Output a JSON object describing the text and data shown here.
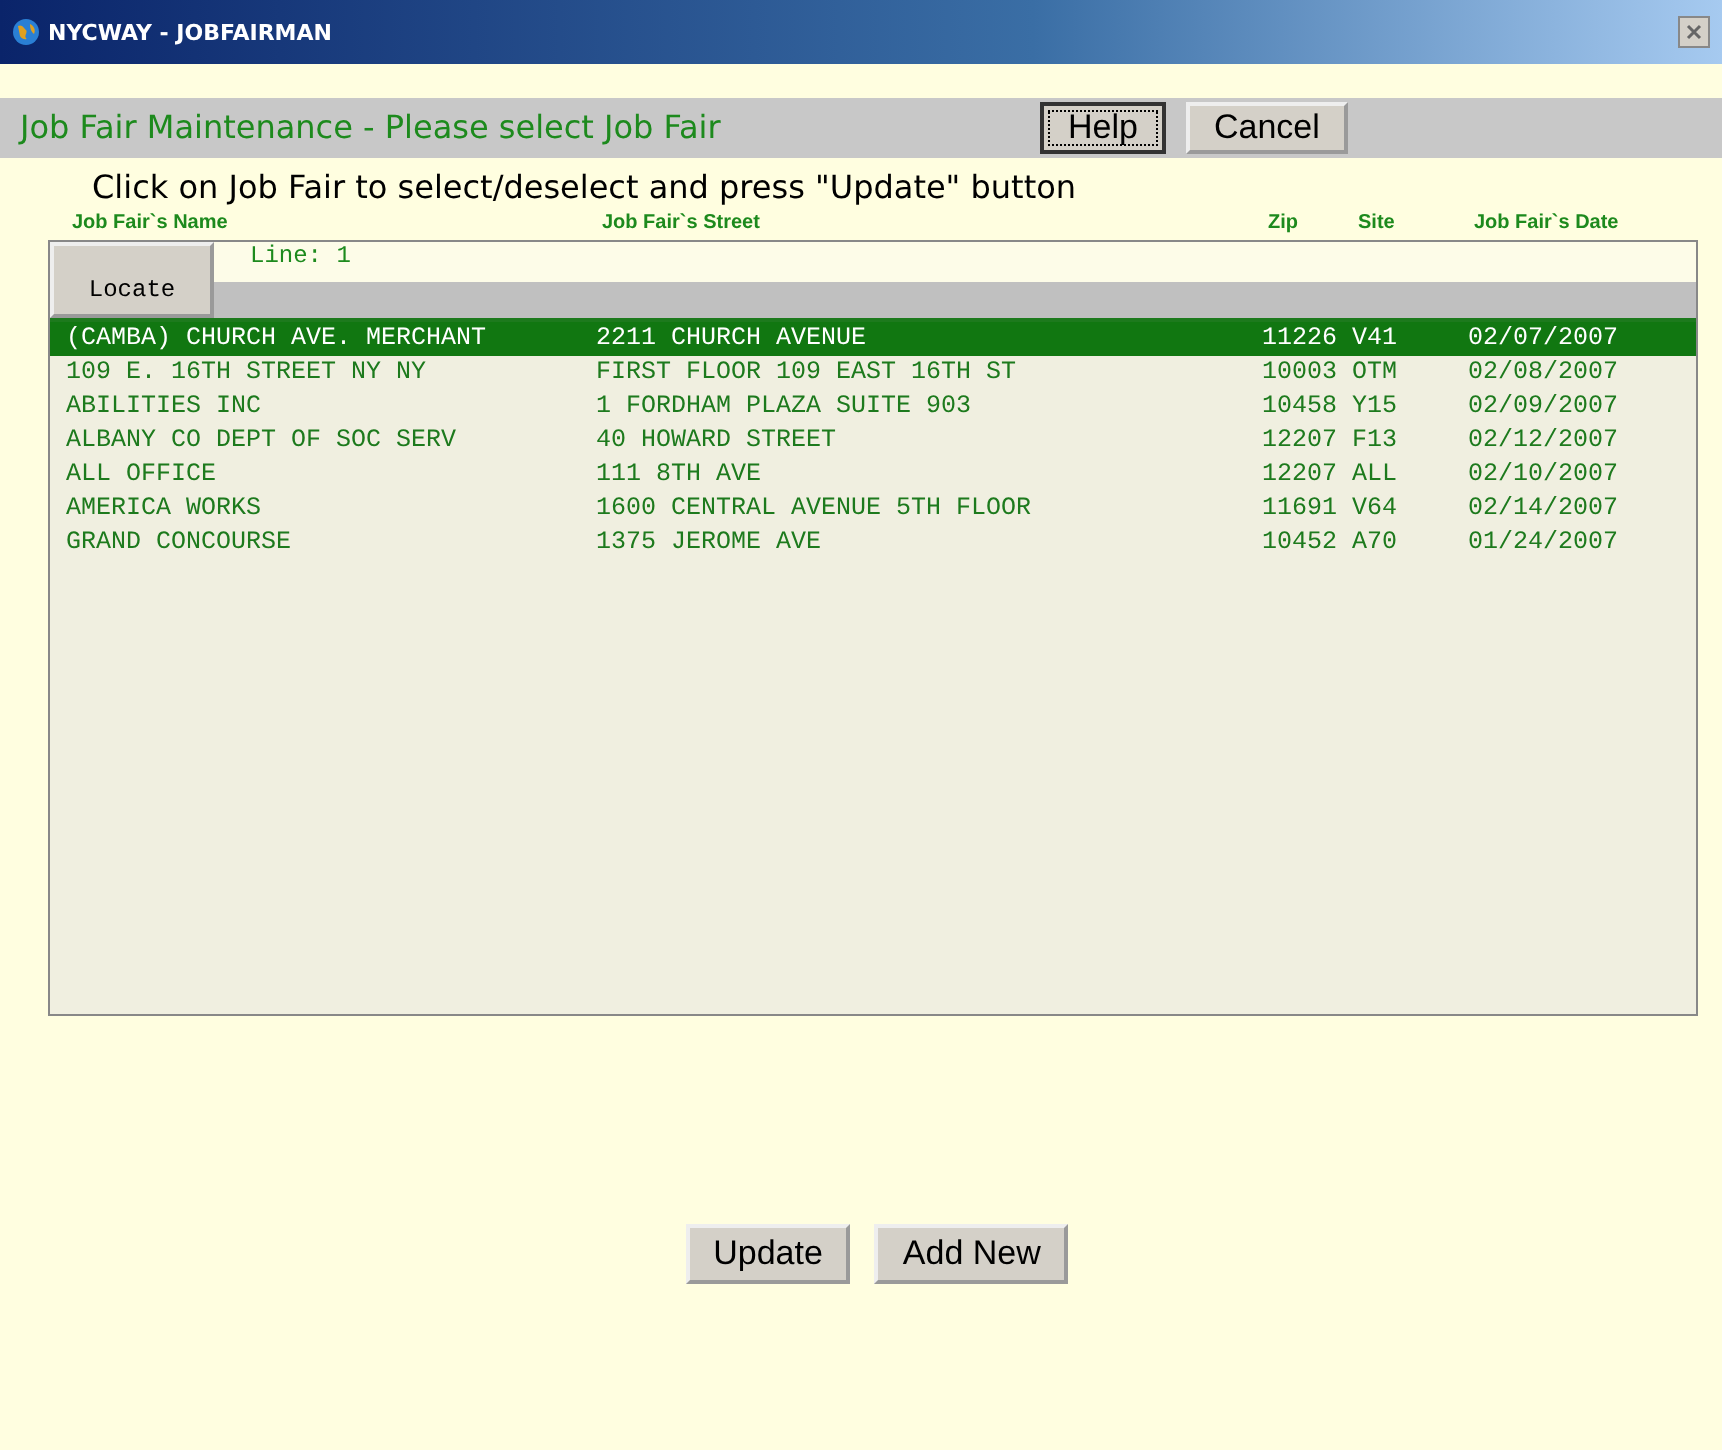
{
  "window": {
    "title": "NYCWAY - JOBFAIRMAN"
  },
  "heading": "Job Fair Maintenance - Please select Job Fair",
  "top_buttons": [
    {
      "label": "Help",
      "focused": true
    },
    {
      "label": "Cancel",
      "focused": false
    }
  ],
  "instruction": "Click on Job Fair to select/deselect and press \"Update\" button",
  "columns": [
    "Job Fair`s Name",
    "Job Fair`s Street",
    "Zip",
    "Site",
    "Job Fair`s Date"
  ],
  "locate": {
    "button": "Locate",
    "line_label": "Line: 1"
  },
  "rows": [
    {
      "cells": [
        "(CAMBA) CHURCH AVE. MERCHANT",
        "2211 CHURCH AVENUE",
        "11226",
        "V41",
        "02/07/2007"
      ],
      "selected": true
    },
    {
      "cells": [
        "109 E. 16TH STREET NY NY",
        "FIRST FLOOR 109 EAST 16TH ST",
        "10003",
        "OTM",
        "02/08/2007"
      ],
      "selected": false
    },
    {
      "cells": [
        "ABILITIES INC",
        "1 FORDHAM PLAZA SUITE 903",
        "10458",
        "Y15",
        "02/09/2007"
      ],
      "selected": false
    },
    {
      "cells": [
        "ALBANY CO DEPT OF SOC SERV",
        "40 HOWARD STREET",
        "12207",
        "F13",
        "02/12/2007"
      ],
      "selected": false
    },
    {
      "cells": [
        "ALL OFFICE",
        "111 8TH AVE",
        "12207",
        "ALL",
        "02/10/2007"
      ],
      "selected": false
    },
    {
      "cells": [
        "AMERICA WORKS",
        "1600 CENTRAL AVENUE 5TH FLOOR",
        "11691",
        "V64",
        "02/14/2007"
      ],
      "selected": false
    },
    {
      "cells": [
        "GRAND CONCOURSE",
        "1375 JEROME AVE",
        "10452",
        "A70",
        "01/24/2007"
      ],
      "selected": false
    }
  ],
  "bottom_buttons": [
    "Update",
    "Add New"
  ]
}
